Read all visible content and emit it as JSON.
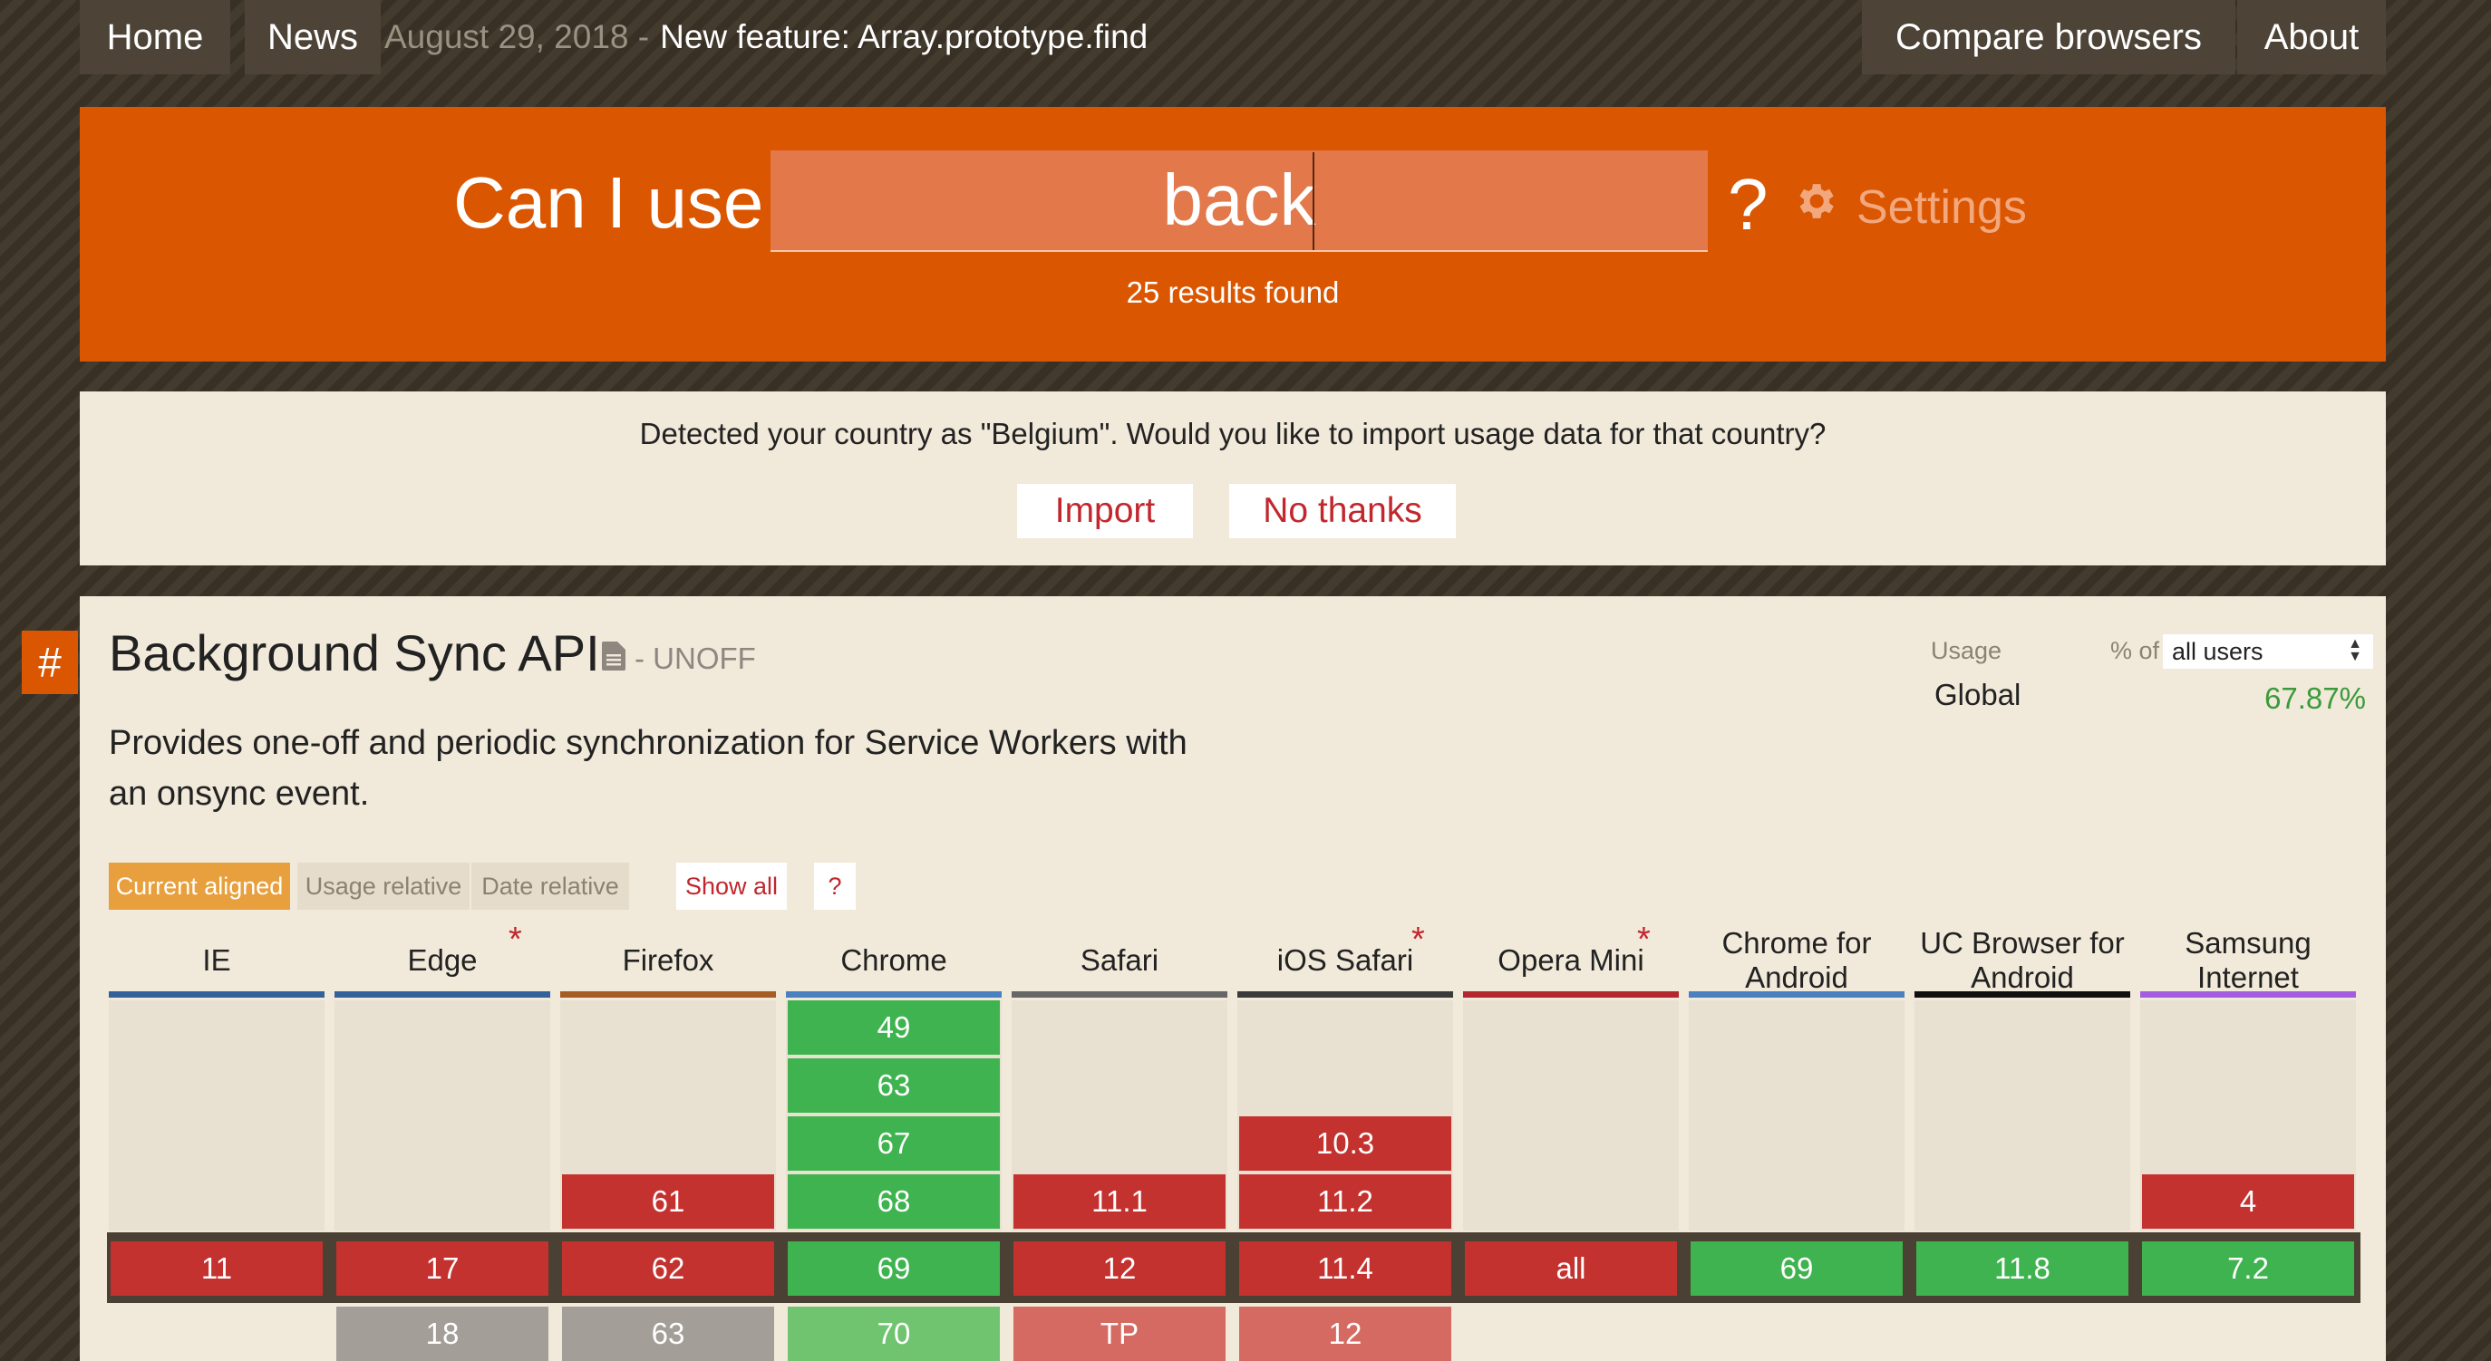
{
  "nav": {
    "home": "Home",
    "news": "News",
    "date": "August 29, 2018 -",
    "headline": "New feature: Array.prototype.find",
    "compare": "Compare browsers",
    "about": "About"
  },
  "search": {
    "prefix": "Can I use",
    "value": "back",
    "suffix": "?",
    "settings": "Settings",
    "results": "25 results found"
  },
  "notice": {
    "text": "Detected your country as \"Belgium\". Would you like to import usage data for that country?",
    "import": "Import",
    "no_thanks": "No thanks"
  },
  "feature": {
    "anchor": "#",
    "title": "Background Sync API",
    "status": "- UNOFF",
    "description": "Provides one-off and periodic synchronization for Service Workers with an onsync event.",
    "usage_label": "Usage",
    "pct_of": "% of",
    "user_scope": "all users",
    "global_label": "Global",
    "global_value": "67.87%"
  },
  "views": {
    "current_aligned": "Current aligned",
    "usage_relative": "Usage relative",
    "date_relative": "Date relative",
    "show_all": "Show all",
    "help": "?"
  },
  "colors": {
    "supported": "#3fb34f",
    "unsupported": "#c4322f",
    "future_supported": "#70c46f",
    "future_unsupported": "#d46a62",
    "future_unknown": "#a39e98",
    "banner": "#db5600"
  },
  "browsers": [
    {
      "name": "IE",
      "star": false,
      "bar": "#35619b",
      "past": [],
      "current": {
        "v": "11",
        "s": "n"
      },
      "future": []
    },
    {
      "name": "Edge",
      "star": true,
      "bar": "#35619b",
      "past": [],
      "current": {
        "v": "17",
        "s": "n"
      },
      "future": [
        {
          "v": "18",
          "s": "u"
        }
      ]
    },
    {
      "name": "Firefox",
      "star": false,
      "bar": "#a55d24",
      "past": [
        {
          "v": "61",
          "s": "n"
        }
      ],
      "current": {
        "v": "62",
        "s": "n"
      },
      "future": [
        {
          "v": "63",
          "s": "u"
        }
      ]
    },
    {
      "name": "Chrome",
      "star": false,
      "bar": "#4a7fc0",
      "past": [
        {
          "v": "49",
          "s": "y"
        },
        {
          "v": "63",
          "s": "y"
        },
        {
          "v": "67",
          "s": "y"
        },
        {
          "v": "68",
          "s": "y"
        }
      ],
      "current": {
        "v": "69",
        "s": "y"
      },
      "future": [
        {
          "v": "70",
          "s": "fy"
        }
      ]
    },
    {
      "name": "Safari",
      "star": false,
      "bar": "#676767",
      "past": [
        {
          "v": "11.1",
          "s": "n"
        }
      ],
      "current": {
        "v": "12",
        "s": "n"
      },
      "future": [
        {
          "v": "TP",
          "s": "fn"
        }
      ]
    },
    {
      "name": "iOS Safari",
      "star": true,
      "bar": "#3b3b3b",
      "past": [
        {
          "v": "10.3",
          "s": "n"
        },
        {
          "v": "11.2",
          "s": "n"
        }
      ],
      "current": {
        "v": "11.4",
        "s": "n"
      },
      "future": [
        {
          "v": "12",
          "s": "fn"
        }
      ]
    },
    {
      "name": "Opera Mini",
      "star": true,
      "bar": "#b3272f",
      "past": [],
      "current": {
        "v": "all",
        "s": "n"
      },
      "future": []
    },
    {
      "name": "Chrome for Android",
      "star": false,
      "bar": "#4a7fc0",
      "past": [],
      "current": {
        "v": "69",
        "s": "y"
      },
      "future": []
    },
    {
      "name": "UC Browser for Android",
      "star": false,
      "bar": "#111111",
      "past": [],
      "current": {
        "v": "11.8",
        "s": "y"
      },
      "future": []
    },
    {
      "name": "Samsung Internet",
      "star": false,
      "bar": "#a35ee0",
      "past": [
        {
          "v": "4",
          "s": "n"
        }
      ],
      "current": {
        "v": "7.2",
        "s": "y"
      },
      "future": []
    }
  ]
}
